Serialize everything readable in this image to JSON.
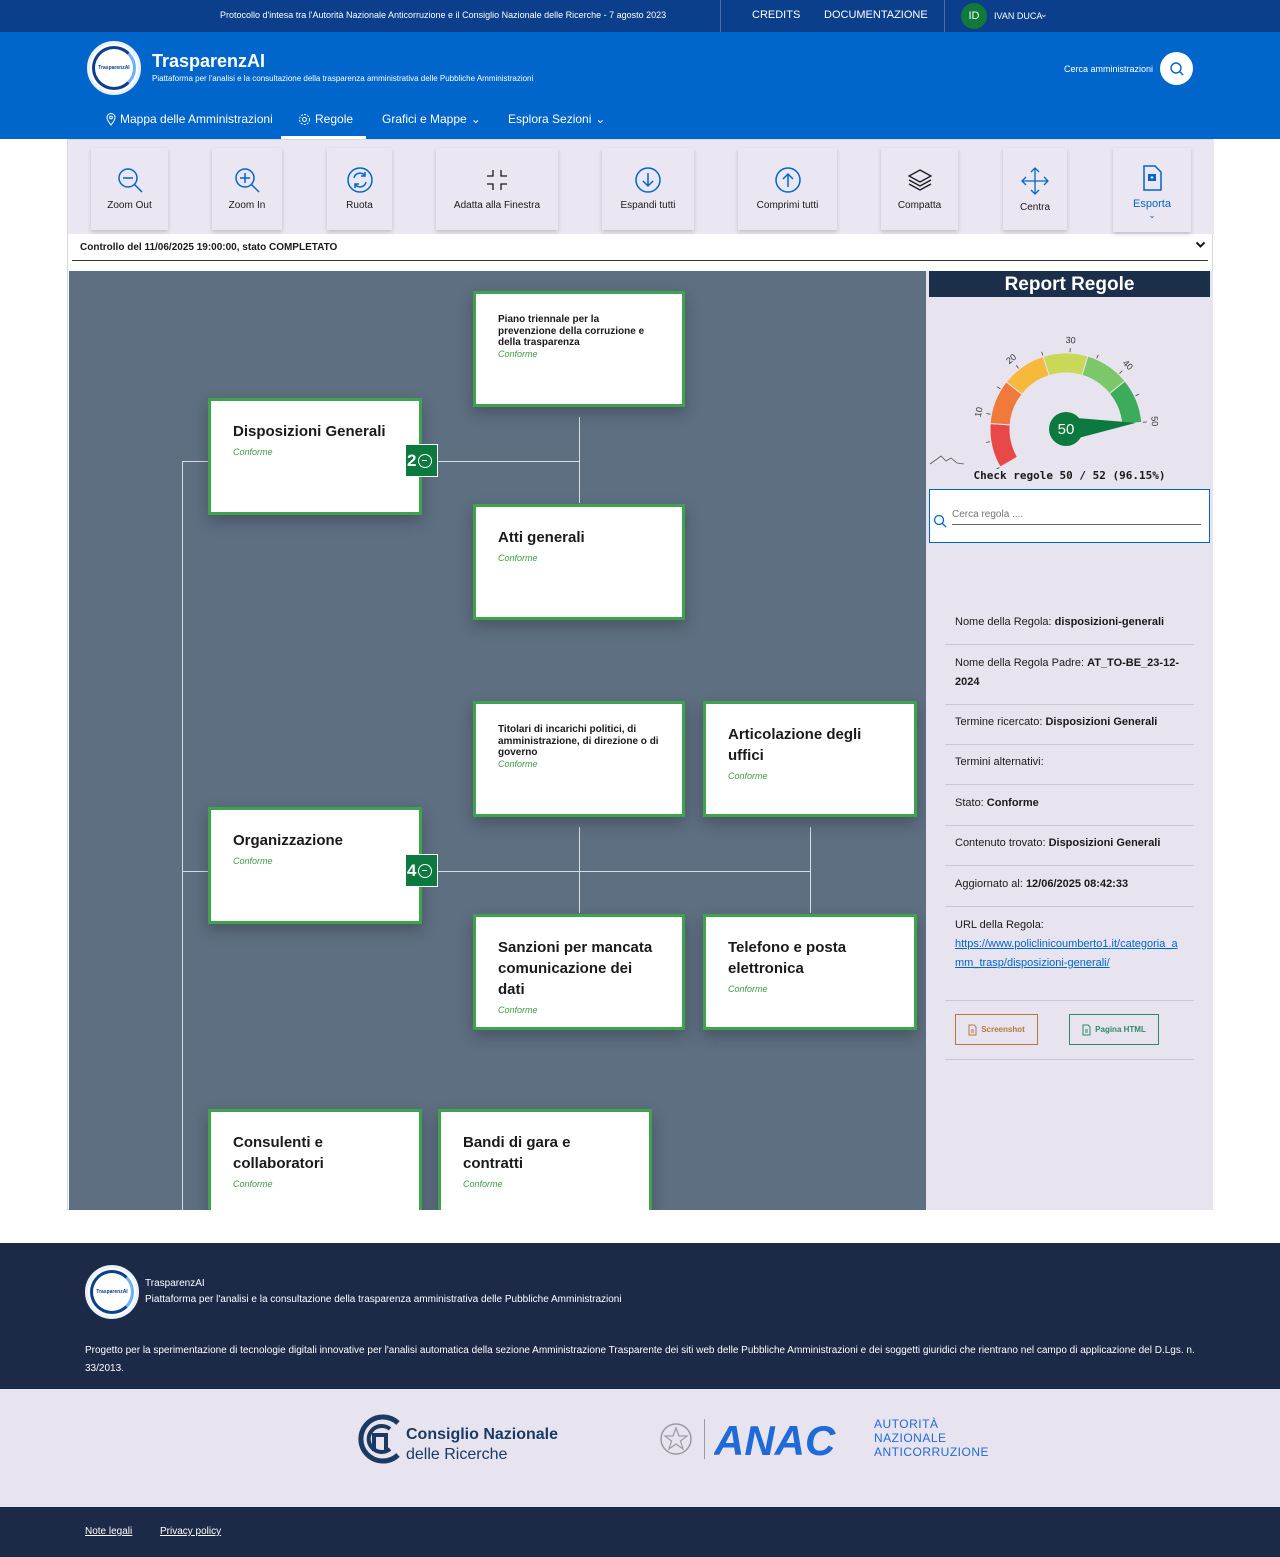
{
  "topbar": {
    "protocol": "Protocollo d'intesa tra l'Autorità Nazionale Anticorruzione e il Consiglio Nazionale delle Ricerche - 7 agosto 2023",
    "credits": "CREDITS",
    "docs": "DOCUMENTAZIONE",
    "user_initials": "ID",
    "user_name": "IVAN DUCA"
  },
  "header": {
    "logo_text": "TrasparenzAI",
    "brand": "TrasparenzAI",
    "tagline": "Piattaforma per l'analisi e la consultazione della trasparenza amministrativa delle Pubbliche Amministrazioni",
    "search_label": "Cerca amministrazioni"
  },
  "nav": {
    "items": [
      "Mappa delle Amministrazioni",
      "Regole",
      "Grafici e Mappe",
      "Esplora Sezioni"
    ]
  },
  "toolbar": {
    "buttons": [
      "Zoom Out",
      "Zoom In",
      "Ruota",
      "Adatta alla Finestra",
      "Espandi tutti",
      "Comprimi tutti",
      "Compatta",
      "Centra",
      "Esporta"
    ]
  },
  "control": {
    "label": "Controllo del 11/06/2025 19:00:00, stato COMPLETATO"
  },
  "tree": {
    "nodes": [
      {
        "title": "Piano triennale per la prevenzione della corruzione e della trasparenza",
        "status": "Conforme"
      },
      {
        "title": "Disposizioni Generali",
        "status": "Conforme",
        "count": "2"
      },
      {
        "title": "Atti generali",
        "status": "Conforme"
      },
      {
        "title": "Titolari di incarichi politici, di amministrazione, di direzione o di governo",
        "status": "Conforme"
      },
      {
        "title": "Articolazione degli uffici",
        "status": "Conforme"
      },
      {
        "title": "Organizzazione",
        "status": "Conforme",
        "count": "4"
      },
      {
        "title": "Sanzioni per mancata comunicazione dei dati",
        "status": "Conforme"
      },
      {
        "title": "Telefono e posta elettronica",
        "status": "Conforme"
      },
      {
        "title": "Consulenti e collaboratori",
        "status": "Conforme"
      },
      {
        "title": "Bandi di gara e contratti",
        "status": "Conforme"
      }
    ]
  },
  "report": {
    "title": "Report Regole",
    "gauge": {
      "value": "50",
      "value_num": 50,
      "max": 52,
      "ticks": [
        "0",
        "10",
        "20",
        "30",
        "40",
        "50"
      ],
      "colors": [
        "#e94848",
        "#ef7a3c",
        "#f6b93b",
        "#c9d957",
        "#7cc768",
        "#3dab5c"
      ]
    },
    "check": "Check regole 50 / 52 (96.15%)",
    "search_placeholder": "Cerca regola ....",
    "fields": {
      "nome_label": "Nome della Regola: ",
      "nome_value": "disposizioni-generali",
      "padre_label": "Nome della Regola Padre: ",
      "padre_value": "AT_TO-BE_23-12-2024",
      "termine_label": "Termine ricercato: ",
      "termine_value": "Disposizioni Generali",
      "alternativi_label": "Termini alternativi:",
      "stato_label": "Stato: ",
      "stato_value": "Conforme",
      "contenuto_label": "Contenuto trovato: ",
      "contenuto_value": "Disposizioni Generali",
      "aggiornato_label": "Aggiornato al: ",
      "aggiornato_value": "12/06/2025 08:42:33",
      "url_label": "URL della Regola:",
      "url_value": "https://www.policlinicoumberto1.it/categoria_amm_trasp/disposizioni-generali/"
    },
    "screenshot_label": "Screenshot",
    "html_label": "Pagina HTML"
  },
  "footer": {
    "logo_text": "TrasparenzAI",
    "brand": "TrasparenzAI",
    "tagline": "Piattaforma per l'analisi e la consultazione della trasparenza amministrativa delle Pubbliche Amministrazioni",
    "description": "Progetto per la sperimentazione di tecnologie digitali innovative per l'analisi automatica della sezione Amministrazione Trasparente dei siti web delle Pubbliche Amministrazioni e dei soggetti giuridici che rientrano nel campo di applicazione del D.Lgs. n. 33/2013."
  },
  "partners": {
    "cnr_line1": "Consiglio Nazionale",
    "cnr_line2": "delle Ricerche",
    "anac_logo": "ANAC",
    "anac_line1": "AUTORITÀ",
    "anac_line2": "NAZIONALE",
    "anac_line3": "ANTICORRUZIONE"
  },
  "legal": {
    "note": "Note legali",
    "privacy": "Privacy policy"
  }
}
